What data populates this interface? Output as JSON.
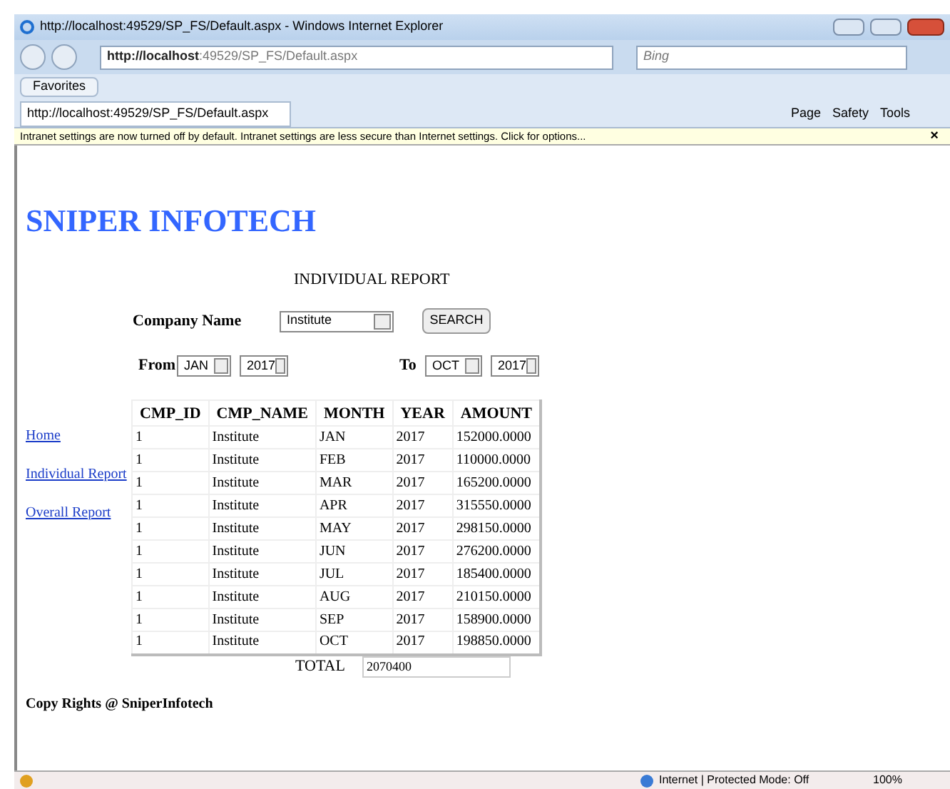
{
  "window": {
    "title": "http://localhost:49529/SP_FS/Default.aspx - Windows Internet Explorer"
  },
  "address_bar": {
    "url_host": "http://localhost",
    "url_rest": ":49529/SP_FS/Default.aspx"
  },
  "search": {
    "placeholder": "Bing"
  },
  "favorites": {
    "label": "Favorites"
  },
  "tab": {
    "label": "http://localhost:49529/SP_FS/Default.aspx"
  },
  "command_bar": [
    "Page",
    "Safety",
    "Tools"
  ],
  "info_bar": {
    "text": "Intranet settings are now turned off by default. Intranet settings are less secure than Internet settings. Click for options...",
    "close": "×"
  },
  "page": {
    "brand": "SNIPER INFOTECH",
    "heading": "INDIVIDUAL REPORT",
    "company_label": "Company Name",
    "company_value": "Institute",
    "search_button": "SEARCH",
    "from_label": "From",
    "from_month": "JAN",
    "from_year": "2017",
    "to_label": "To",
    "to_month": "OCT",
    "to_year": "2017",
    "nav": [
      "Home",
      "Individual Report",
      "Overall Report"
    ],
    "table": {
      "columns": [
        "CMP_ID",
        "CMP_NAME",
        "MONTH",
        "YEAR",
        "AMOUNT"
      ],
      "rows": [
        [
          "1",
          "Institute",
          "JAN",
          "2017",
          "152000.0000"
        ],
        [
          "1",
          "Institute",
          "FEB",
          "2017",
          "110000.0000"
        ],
        [
          "1",
          "Institute",
          "MAR",
          "2017",
          "165200.0000"
        ],
        [
          "1",
          "Institute",
          "APR",
          "2017",
          "315550.0000"
        ],
        [
          "1",
          "Institute",
          "MAY",
          "2017",
          "298150.0000"
        ],
        [
          "1",
          "Institute",
          "JUN",
          "2017",
          "276200.0000"
        ],
        [
          "1",
          "Institute",
          "JUL",
          "2017",
          "185400.0000"
        ],
        [
          "1",
          "Institute",
          "AUG",
          "2017",
          "210150.0000"
        ],
        [
          "1",
          "Institute",
          "SEP",
          "2017",
          "158900.0000"
        ],
        [
          "1",
          "Institute",
          "OCT",
          "2017",
          "198850.0000"
        ]
      ]
    },
    "total_label": "TOTAL",
    "total_value": "2070400",
    "footer": "Copy Rights @ SniperInfotech"
  },
  "status_bar": {
    "zone": "Internet | Protected Mode: Off",
    "zoom": "100%"
  }
}
